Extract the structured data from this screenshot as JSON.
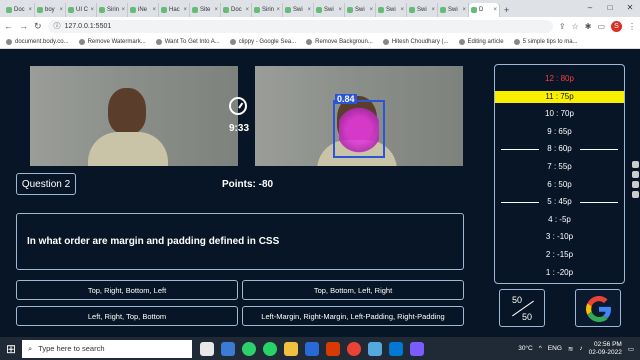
{
  "browser": {
    "tabs": [
      {
        "label": "Doc"
      },
      {
        "label": "boy"
      },
      {
        "label": "UI C"
      },
      {
        "label": "Sirin"
      },
      {
        "label": "iNe"
      },
      {
        "label": "Hac"
      },
      {
        "label": "Site"
      },
      {
        "label": "Doc"
      },
      {
        "label": "Sirin"
      },
      {
        "label": "Swi"
      },
      {
        "label": "Swi"
      },
      {
        "label": "Swi"
      },
      {
        "label": "Swi"
      },
      {
        "label": "Swi"
      },
      {
        "label": "Swi"
      },
      {
        "label": "D"
      }
    ],
    "url": "127.0.0.1:5501",
    "profile_initial": "S",
    "bookmarks": [
      "document.body.co...",
      "Remove Watermark...",
      "Want To Get Into A...",
      "clippy - Google Sea...",
      "Remove Backgroun...",
      "Hitesh Choudhary (...",
      "Editing article",
      "5 simple tips to ma..."
    ]
  },
  "quiz": {
    "timer": "9:33",
    "question_label": "Question 2",
    "points": "Points: -80",
    "question_text": "In what order are margin and padding defined in CSS",
    "options": [
      "Top, Right, Bottom, Left",
      "Top, Bottom, Left, Right",
      "Left, Right, Top, Bottom",
      "Left-Margin, Right-Margin, Left-Padding, Right-Padding"
    ],
    "detection_confidence": "0.84",
    "ladder": [
      {
        "label": "12 : 80p",
        "state": "top"
      },
      {
        "label": "11 : 75p",
        "state": "current"
      },
      {
        "label": "10 : 70p",
        "state": ""
      },
      {
        "label": "9 : 65p",
        "state": ""
      },
      {
        "label": "8 : 60p",
        "state": "milestone"
      },
      {
        "label": "7 : 55p",
        "state": ""
      },
      {
        "label": "6 : 50p",
        "state": ""
      },
      {
        "label": "5 : 45p",
        "state": "milestone"
      },
      {
        "label": "4 : -5p",
        "state": ""
      },
      {
        "label": "3 : -10p",
        "state": ""
      },
      {
        "label": "2 : -15p",
        "state": ""
      },
      {
        "label": "1 : -20p",
        "state": ""
      }
    ],
    "lifeline_fifty_top": "50",
    "lifeline_fifty_bottom": "50"
  },
  "taskbar": {
    "search_placeholder": "Type here to search",
    "temperature": "30°C",
    "language": "ENG",
    "time": "02:56 PM",
    "date": "02-09-2022"
  },
  "colors": {
    "app_bg": "#071526",
    "border": "#9fb8d6",
    "current_rung": "#f8f000",
    "top_rung": "#ff3b3b"
  }
}
